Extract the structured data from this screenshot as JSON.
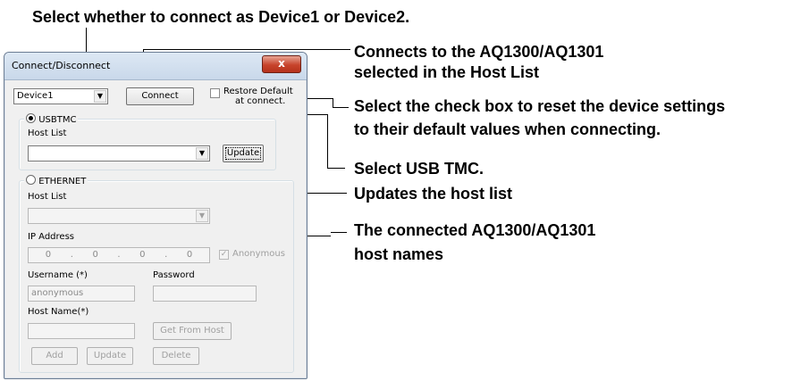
{
  "annotations": {
    "device_select": "Select whether to connect as Device1 or Device2.",
    "connect_line1": "Connects to the AQ1300/AQ1301",
    "connect_line2": "selected in the Host List",
    "restore_line1": "Select the check box to reset the device settings",
    "restore_line2": "to their default values when connecting.",
    "usbtmc": "Select USB TMC.",
    "update": "Updates the host list",
    "hostnames_line1": "The connected AQ1300/AQ1301",
    "hostnames_line2": "host names"
  },
  "dialog": {
    "title": "Connect/Disconnect",
    "close_glyph": "x",
    "device_select": {
      "value": "Device1",
      "arrow": "▼"
    },
    "connect_label": "Connect",
    "restore_default_line1": "Restore Default",
    "restore_default_line2": "at connect.",
    "usbtmc": {
      "label": "USBTMC",
      "host_list_label": "Host List",
      "host_list_value": "",
      "arrow": "▼",
      "update_label": "Update"
    },
    "ethernet": {
      "label": "ETHERNET",
      "host_list_label": "Host List",
      "arrow": "▼",
      "ip_address_label": "IP Address",
      "ip_octets": [
        "0",
        "0",
        "0",
        "0"
      ],
      "ip_separator": ".",
      "anonymous_label": "Anonymous",
      "anonymous_check": "✓",
      "username_label": "Username (*)",
      "username_value": "anonymous",
      "password_label": "Password",
      "host_name_label": "Host Name(*)",
      "get_from_host_label": "Get From Host",
      "add_label": "Add",
      "update_label": "Update",
      "delete_label": "Delete"
    }
  }
}
